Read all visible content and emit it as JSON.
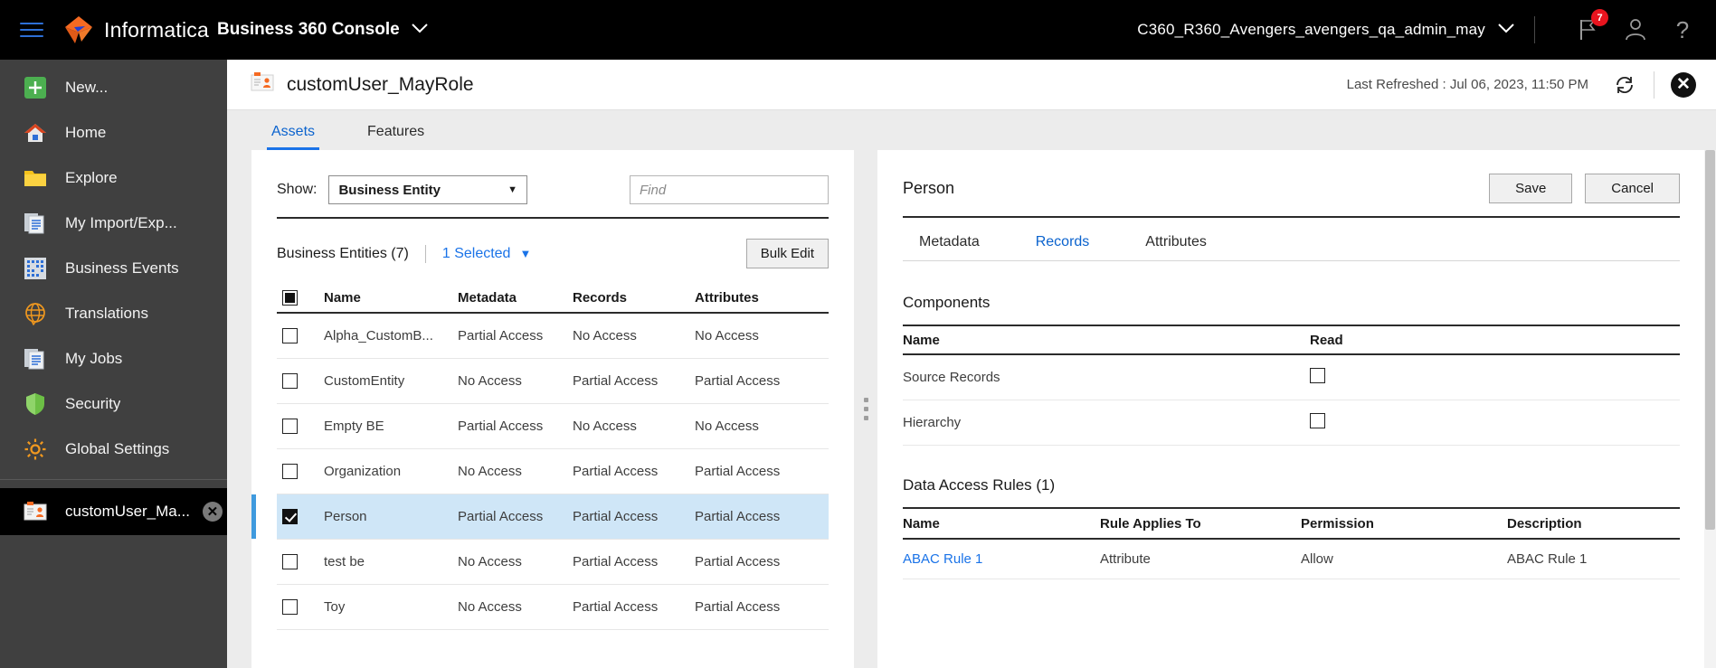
{
  "topbar": {
    "menu_icon": "hamburger-icon",
    "brand": "Informatica",
    "product": "Business 360 Console",
    "product_caret": "⌄",
    "org": "C360_R360_Avengers_avengers_qa_admin_may",
    "org_caret": "⌄",
    "notifications_badge": "7",
    "notification_icon": "flag-icon",
    "user_icon": "user-icon",
    "help_icon": "help-icon",
    "help_glyph": "?"
  },
  "sidebar": {
    "items": [
      {
        "label": "New...",
        "icon": "plus-icon"
      },
      {
        "label": "Home",
        "icon": "home-icon"
      },
      {
        "label": "Explore",
        "icon": "folder-icon"
      },
      {
        "label": "My Import/Exp...",
        "icon": "documents-icon"
      },
      {
        "label": "Business Events",
        "icon": "grid-icon"
      },
      {
        "label": "Translations",
        "icon": "globe-icon"
      },
      {
        "label": "My Jobs",
        "icon": "documents-icon"
      },
      {
        "label": "Security",
        "icon": "shield-icon"
      },
      {
        "label": "Global Settings",
        "icon": "gear-icon"
      }
    ],
    "active_tab": {
      "label": "customUser_Ma...",
      "icon": "role-card-icon",
      "close_glyph": "✕"
    }
  },
  "page": {
    "title": "customUser_MayRole",
    "title_icon": "role-card-icon",
    "last_refreshed": "Last Refreshed : Jul 06, 2023, 11:50 PM",
    "refresh_icon": "refresh-icon",
    "close_icon": "close-icon",
    "close_glyph": "✕",
    "tabs": [
      {
        "label": "Assets",
        "active": true
      },
      {
        "label": "Features",
        "active": false
      }
    ]
  },
  "left_pane": {
    "show_label": "Show:",
    "show_value": "Business Entity",
    "show_caret": "▼",
    "find_placeholder": "Find",
    "find_value": "",
    "count_label": "Business Entities (7)",
    "selected_label": "1 Selected",
    "selected_caret": "▼",
    "bulk_edit_label": "Bulk Edit",
    "columns": [
      "Name",
      "Metadata",
      "Records",
      "Attributes"
    ],
    "header_checkbox_state": "partial",
    "rows": [
      {
        "checked": false,
        "name": "Alpha_CustomB...",
        "metadata": "Partial Access",
        "records": "No Access",
        "attributes": "No Access",
        "selected": false
      },
      {
        "checked": false,
        "name": "CustomEntity",
        "metadata": "No Access",
        "records": "Partial Access",
        "attributes": "Partial Access",
        "selected": false
      },
      {
        "checked": false,
        "name": "Empty BE",
        "metadata": "Partial Access",
        "records": "No Access",
        "attributes": "No Access",
        "selected": false
      },
      {
        "checked": false,
        "name": "Organization",
        "metadata": "No Access",
        "records": "Partial Access",
        "attributes": "Partial Access",
        "selected": false
      },
      {
        "checked": true,
        "name": "Person",
        "metadata": "Partial Access",
        "records": "Partial Access",
        "attributes": "Partial Access",
        "selected": true
      },
      {
        "checked": false,
        "name": "test be",
        "metadata": "No Access",
        "records": "Partial Access",
        "attributes": "Partial Access",
        "selected": false
      },
      {
        "checked": false,
        "name": "Toy",
        "metadata": "No Access",
        "records": "Partial Access",
        "attributes": "Partial Access",
        "selected": false
      }
    ]
  },
  "right_pane": {
    "title": "Person",
    "save_label": "Save",
    "cancel_label": "Cancel",
    "tabs": [
      {
        "label": "Metadata",
        "active": false
      },
      {
        "label": "Records",
        "active": true
      },
      {
        "label": "Attributes",
        "active": false
      }
    ],
    "components": {
      "section_title": "Components",
      "columns": [
        "Name",
        "Read"
      ],
      "rows": [
        {
          "name": "Source Records",
          "read": false
        },
        {
          "name": "Hierarchy",
          "read": false
        }
      ]
    },
    "data_access_rules": {
      "section_title": "Data Access Rules (1)",
      "columns": [
        "Name",
        "Rule Applies To",
        "Permission",
        "Description"
      ],
      "rows": [
        {
          "name": "ABAC Rule 1",
          "applies_to": "Attribute",
          "permission": "Allow",
          "description": "ABAC Rule 1"
        }
      ]
    }
  },
  "colors": {
    "accent_blue": "#1a73e8",
    "brand_orange": "#f56a22",
    "topbar_bg": "#000000",
    "sidebar_bg": "#404040",
    "selected_row": "#cfe6f7",
    "badge_red": "#e8141e"
  }
}
